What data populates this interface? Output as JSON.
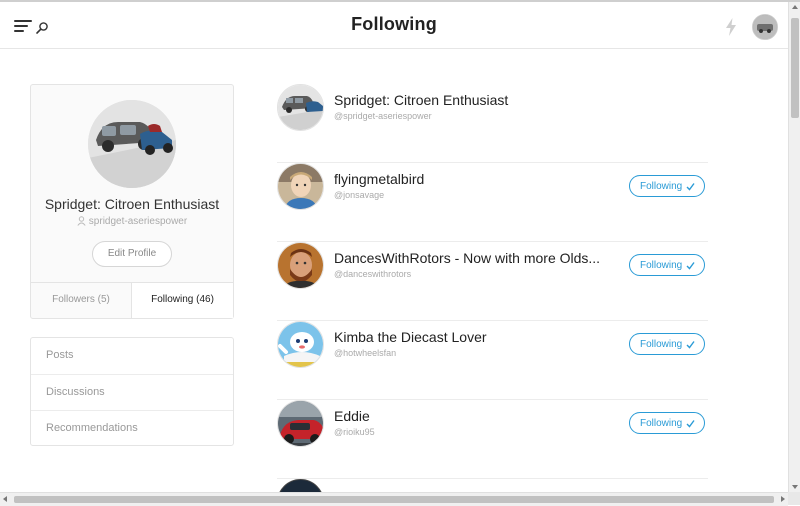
{
  "header": {
    "title": "Following",
    "menu_icon": "hamburger-menu-icon",
    "search_icon": "search-icon",
    "bolt_icon": "lightning-bolt-icon"
  },
  "profile": {
    "name": "Spridget: Citroen Enthusiast",
    "handle": "spridget-aseriespower",
    "edit_label": "Edit Profile",
    "followers_label": "Followers (5)",
    "following_label": "Following (46)"
  },
  "side_nav": {
    "items": [
      {
        "label": "Posts"
      },
      {
        "label": "Discussions"
      },
      {
        "label": "Recommendations"
      }
    ]
  },
  "following": {
    "button_label": "Following",
    "rows": [
      {
        "name": "Spridget: Citroen Enthusiast",
        "handle": "@spridget-aseriespower"
      },
      {
        "name": "flyingmetalbird",
        "handle": "@jonsavage"
      },
      {
        "name": "DancesWithRotors - Now with more Olds...",
        "handle": "@danceswithrotors"
      },
      {
        "name": "Kimba the Diecast Lover",
        "handle": "@hotwheelsfan"
      },
      {
        "name": "Eddie",
        "handle": "@rioiku95"
      }
    ]
  },
  "colors": {
    "accent": "#2a9bd6",
    "text": "#222222",
    "muted": "#aaaaaa",
    "border": "#e4e4e4"
  }
}
